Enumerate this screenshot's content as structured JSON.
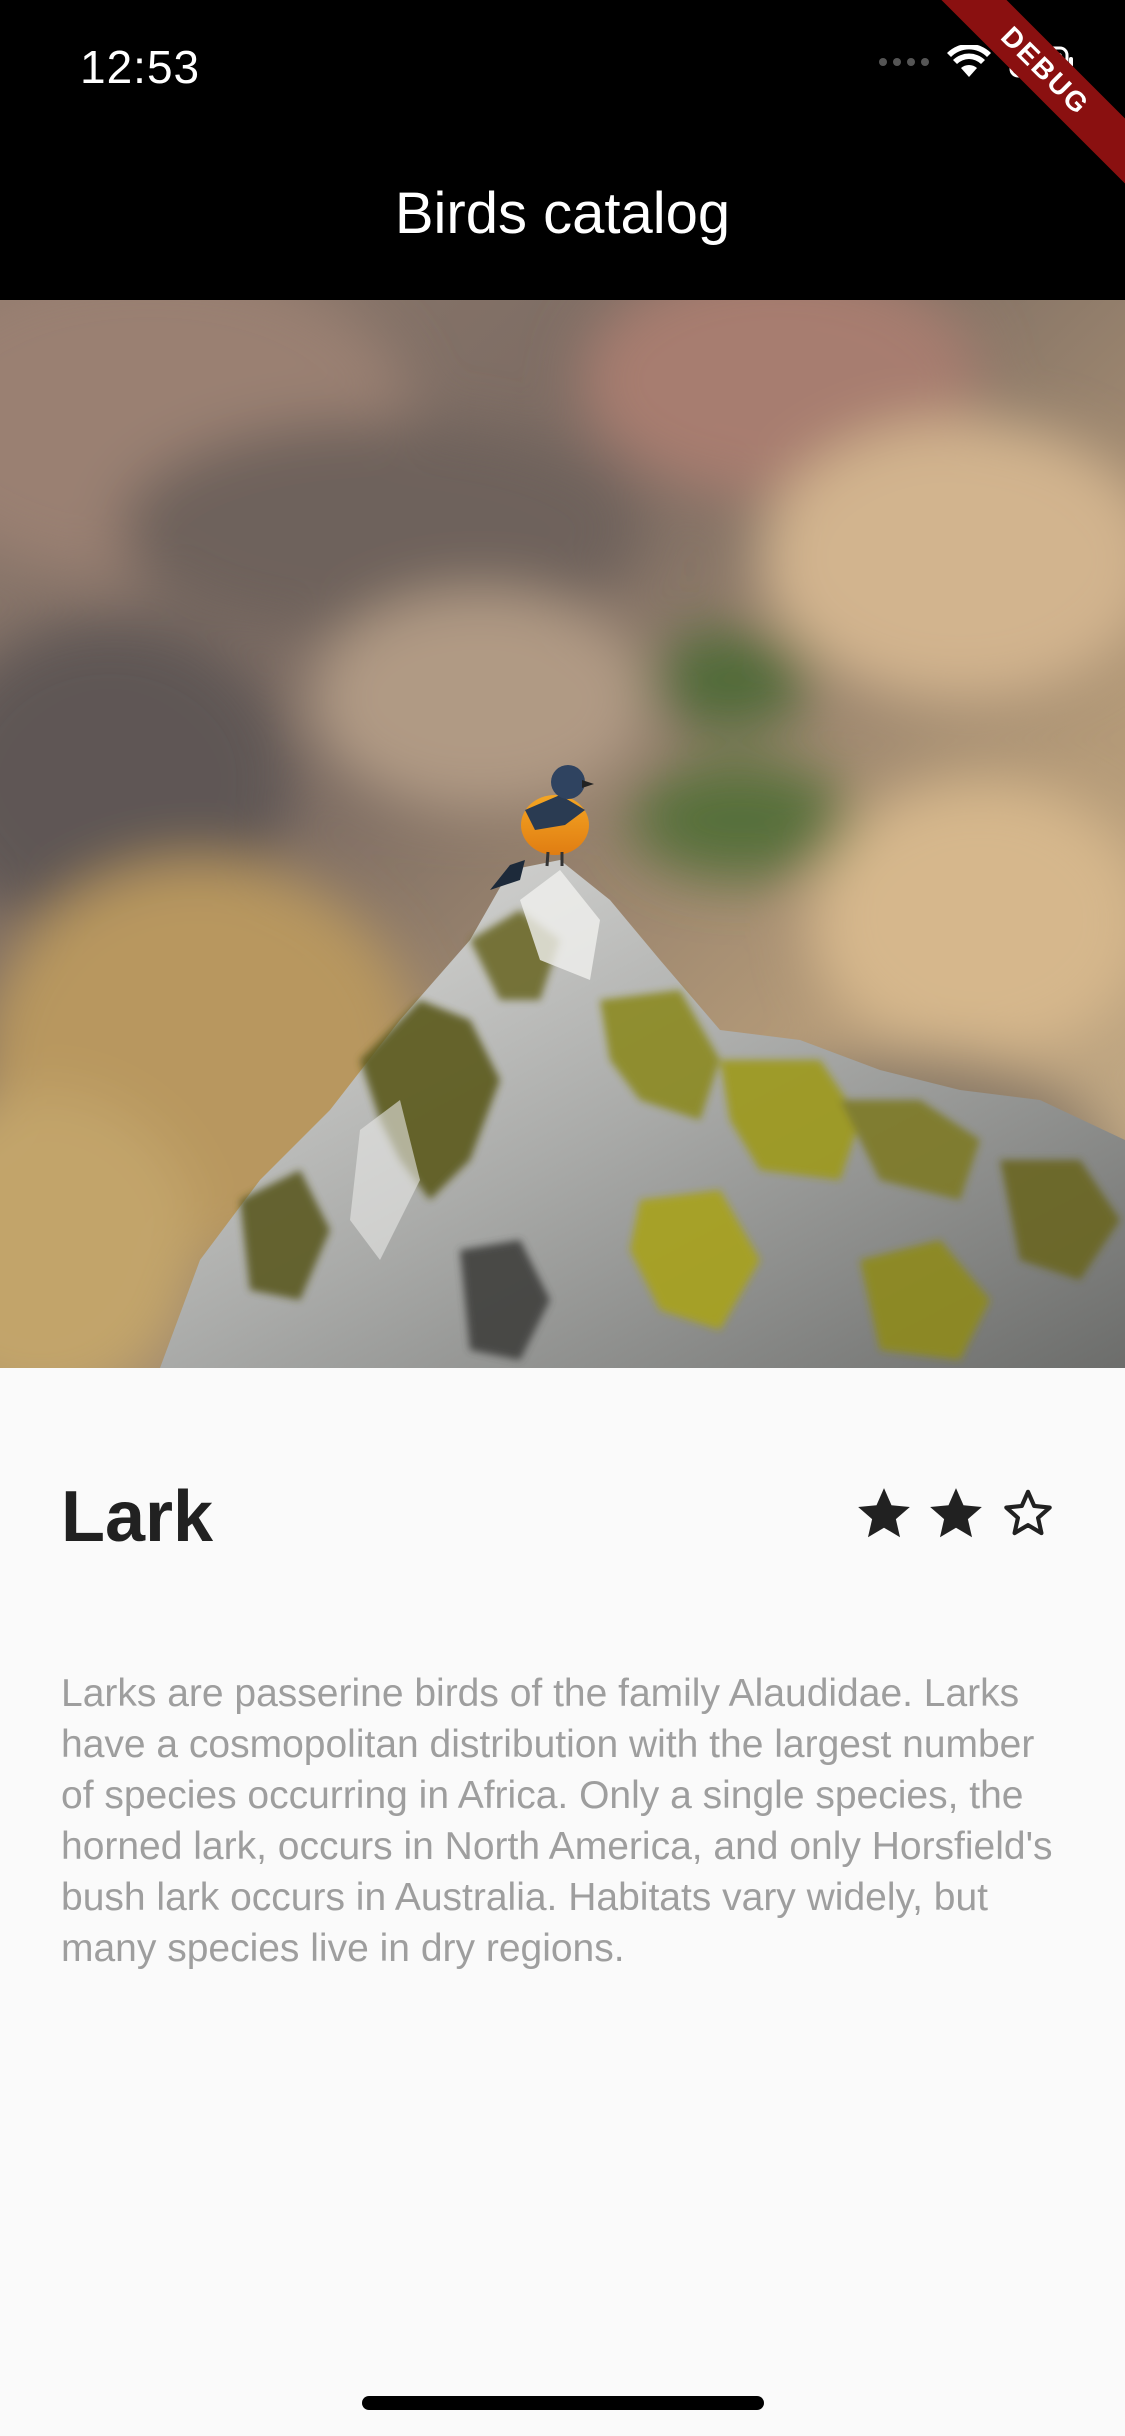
{
  "status_bar": {
    "time": "12:53"
  },
  "app_bar": {
    "title": "Birds catalog"
  },
  "debug_banner": {
    "label": "DEBUG"
  },
  "bird": {
    "name": "Lark",
    "rating": 2,
    "rating_max": 3,
    "description": "Larks are passerine birds of the family Alaudidae. Larks have a cosmopolitan distribution with the largest number of species occurring in Africa. Only a single species, the horned lark, occurs in North America, and only Horsfield's bush lark occurs in Australia. Habitats vary widely, but many species live in dry regions."
  },
  "colors": {
    "app_bar": "#000000",
    "background": "#fafafa",
    "title_text": "#212121",
    "description_text": "#9e9e9e",
    "star": "#212121",
    "debug_ribbon": "#8a1010"
  }
}
